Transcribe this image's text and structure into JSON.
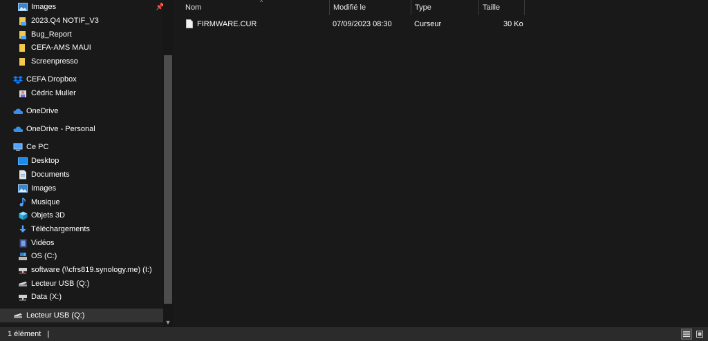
{
  "sidebar": {
    "items": [
      {
        "label": "Images",
        "icon": "images-icon"
      },
      {
        "label": "2023.Q4 NOTIF_V3",
        "icon": "folder-icon"
      },
      {
        "label": "Bug_Report",
        "icon": "folder-icon"
      },
      {
        "label": "CEFA-AMS MAUI",
        "icon": "folder-icon"
      },
      {
        "label": "Screenpresso",
        "icon": "folder-icon"
      },
      {
        "label": "CEFA Dropbox",
        "icon": "dropbox-icon"
      },
      {
        "label": "Cédric Muller",
        "icon": "user-folder-icon"
      },
      {
        "label": "OneDrive",
        "icon": "cloud-icon"
      },
      {
        "label": "OneDrive - Personal",
        "icon": "cloud-icon"
      },
      {
        "label": "Ce PC",
        "icon": "computer-icon"
      },
      {
        "label": "Desktop",
        "icon": "desktop-icon"
      },
      {
        "label": "Documents",
        "icon": "documents-icon"
      },
      {
        "label": "Images",
        "icon": "images-icon"
      },
      {
        "label": "Musique",
        "icon": "music-icon"
      },
      {
        "label": "Objets 3D",
        "icon": "cube-icon"
      },
      {
        "label": "Téléchargements",
        "icon": "download-icon"
      },
      {
        "label": "Vidéos",
        "icon": "video-icon"
      },
      {
        "label": "OS (C:)",
        "icon": "drive-icon"
      },
      {
        "label": "software (\\\\cfrs819.synology.me) (I:)",
        "icon": "network-drive-icon"
      },
      {
        "label": "Lecteur USB (Q:)",
        "icon": "usb-drive-icon"
      },
      {
        "label": "Data (X:)",
        "icon": "network-drive-icon"
      },
      {
        "label": "Lecteur USB (Q:)",
        "icon": "usb-drive-icon"
      }
    ]
  },
  "columns": {
    "name": "Nom",
    "modified": "Modifié le",
    "type": "Type",
    "size": "Taille"
  },
  "files": [
    {
      "name": "FIRMWARE.CUR",
      "modified": "07/09/2023 08:30",
      "type": "Curseur",
      "size": "30 Ko"
    }
  ],
  "status": {
    "count": "1 élément",
    "caret": "|"
  },
  "colors": {
    "background": "#191919",
    "folder": "#f2c94c",
    "accent": "#4ea3ff"
  }
}
